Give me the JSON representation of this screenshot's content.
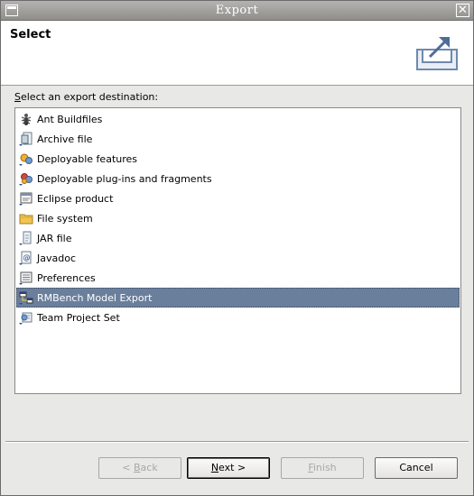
{
  "window": {
    "title": "Export"
  },
  "header": {
    "title": "Select"
  },
  "prompt": {
    "mnemonic": "S",
    "rest": "elect an export destination:"
  },
  "list": {
    "items": [
      {
        "label": "Ant Buildfiles",
        "icon": "ant-icon"
      },
      {
        "label": "Archive file",
        "icon": "archive-file-icon"
      },
      {
        "label": "Deployable features",
        "icon": "feature-icon"
      },
      {
        "label": "Deployable plug-ins and fragments",
        "icon": "plugin-icon"
      },
      {
        "label": "Eclipse product",
        "icon": "product-icon"
      },
      {
        "label": "File system",
        "icon": "folder-icon"
      },
      {
        "label": "JAR file",
        "icon": "jar-icon"
      },
      {
        "label": "Javadoc",
        "icon": "javadoc-icon"
      },
      {
        "label": "Preferences",
        "icon": "preferences-icon"
      },
      {
        "label": "RMBench Model Export",
        "icon": "rmbench-icon"
      },
      {
        "label": "Team Project Set",
        "icon": "team-project-icon"
      }
    ],
    "selected": "RMBench Model Export"
  },
  "buttons": {
    "back": {
      "prefix": "< ",
      "mnemonic": "B",
      "rest": "ack"
    },
    "next": {
      "mnemonic": "N",
      "rest": "ext >"
    },
    "finish": {
      "mnemonic": "F",
      "rest": "inish"
    },
    "cancel": {
      "label": "Cancel"
    }
  }
}
